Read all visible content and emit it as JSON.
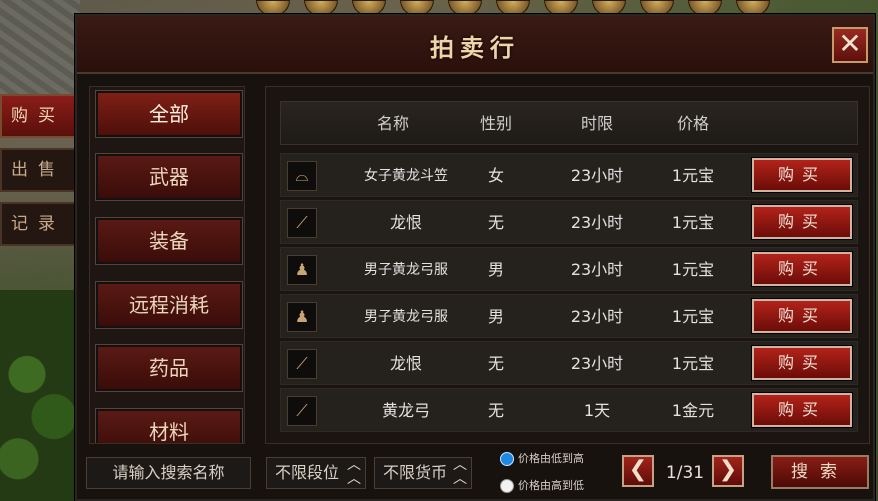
{
  "title": "拍卖行",
  "close_glyph": "✕",
  "side_tabs": [
    {
      "label": "购买",
      "active": true
    },
    {
      "label": "出售",
      "active": false
    },
    {
      "label": "记录",
      "active": false
    }
  ],
  "categories": [
    {
      "label": "全部",
      "active": true
    },
    {
      "label": "武器",
      "active": false
    },
    {
      "label": "装备",
      "active": false
    },
    {
      "label": "远程消耗",
      "active": false
    },
    {
      "label": "药品",
      "active": false
    },
    {
      "label": "材料",
      "active": false
    }
  ],
  "table": {
    "headers": {
      "name": "名称",
      "gender": "性别",
      "duration": "时限",
      "price": "价格"
    },
    "rows": [
      {
        "icon": "hat-icon",
        "name": "女子黄龙斗笠",
        "gender": "女",
        "duration": "23小时",
        "price": "1元宝",
        "action": "购买"
      },
      {
        "icon": "stick-icon",
        "name": "龙恨",
        "gender": "无",
        "duration": "23小时",
        "price": "1元宝",
        "action": "购买"
      },
      {
        "icon": "robe-icon",
        "name": "男子黄龙弓服",
        "gender": "男",
        "duration": "23小时",
        "price": "1元宝",
        "action": "购买"
      },
      {
        "icon": "robe-icon",
        "name": "男子黄龙弓服",
        "gender": "男",
        "duration": "23小时",
        "price": "1元宝",
        "action": "购买"
      },
      {
        "icon": "stick-icon",
        "name": "龙恨",
        "gender": "无",
        "duration": "23小时",
        "price": "1元宝",
        "action": "购买"
      },
      {
        "icon": "bow-icon",
        "name": "黄龙弓",
        "gender": "无",
        "duration": "1天",
        "price": "1金元",
        "action": "购买"
      }
    ]
  },
  "bottom": {
    "search_placeholder": "请输入搜索名称",
    "level_filter": "不限段位",
    "currency_filter": "不限货币",
    "sort_options": [
      {
        "label": "价格由低到高",
        "selected": true
      },
      {
        "label": "价格由高到低",
        "selected": false
      }
    ],
    "page": "1/31",
    "search_label": "搜索"
  },
  "colors": {
    "accent": "#8a1d18",
    "radio_selected": "#1e88e5",
    "panel_bg": "#17120e"
  }
}
